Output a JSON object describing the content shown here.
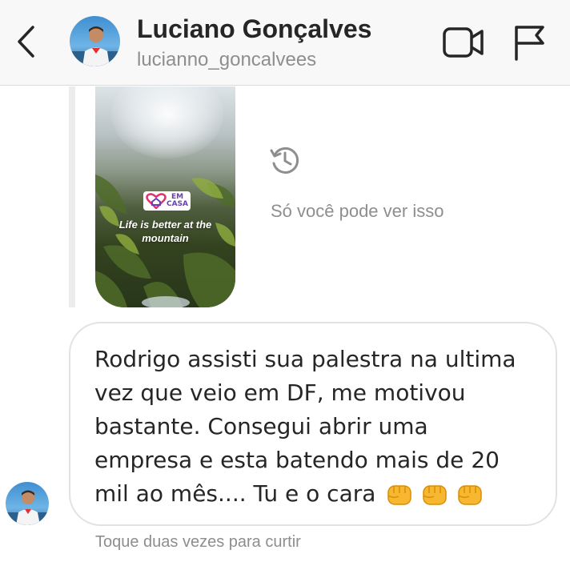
{
  "header": {
    "back_icon": "chevron-left-icon",
    "name": "Luciano Gonçalves",
    "username": "lucianno_goncalvees",
    "video_icon": "video-camera-icon",
    "flag_icon": "flag-icon"
  },
  "story": {
    "badge_line1": "EM",
    "badge_line2": "CASA",
    "caption": "Life is better at the mountain",
    "history_icon": "history-icon",
    "note": "Só você pode ver isso"
  },
  "message": {
    "text": "Rodrigo assisti sua palestra na ultima vez que veio em DF, me motivou bastante. Consegui abrir uma empresa e esta batendo mais de 20 mil ao mês.... Tu e o cara",
    "emoji_icon": "fist-bump-icon",
    "emoji_count": 3,
    "hint": "Toque duas vezes para curtir"
  },
  "colors": {
    "header_bg": "#f8f8f8",
    "secondary_text": "#8e8e8e",
    "primary_text": "#262626",
    "bubble_border": "#e2e2e2"
  }
}
